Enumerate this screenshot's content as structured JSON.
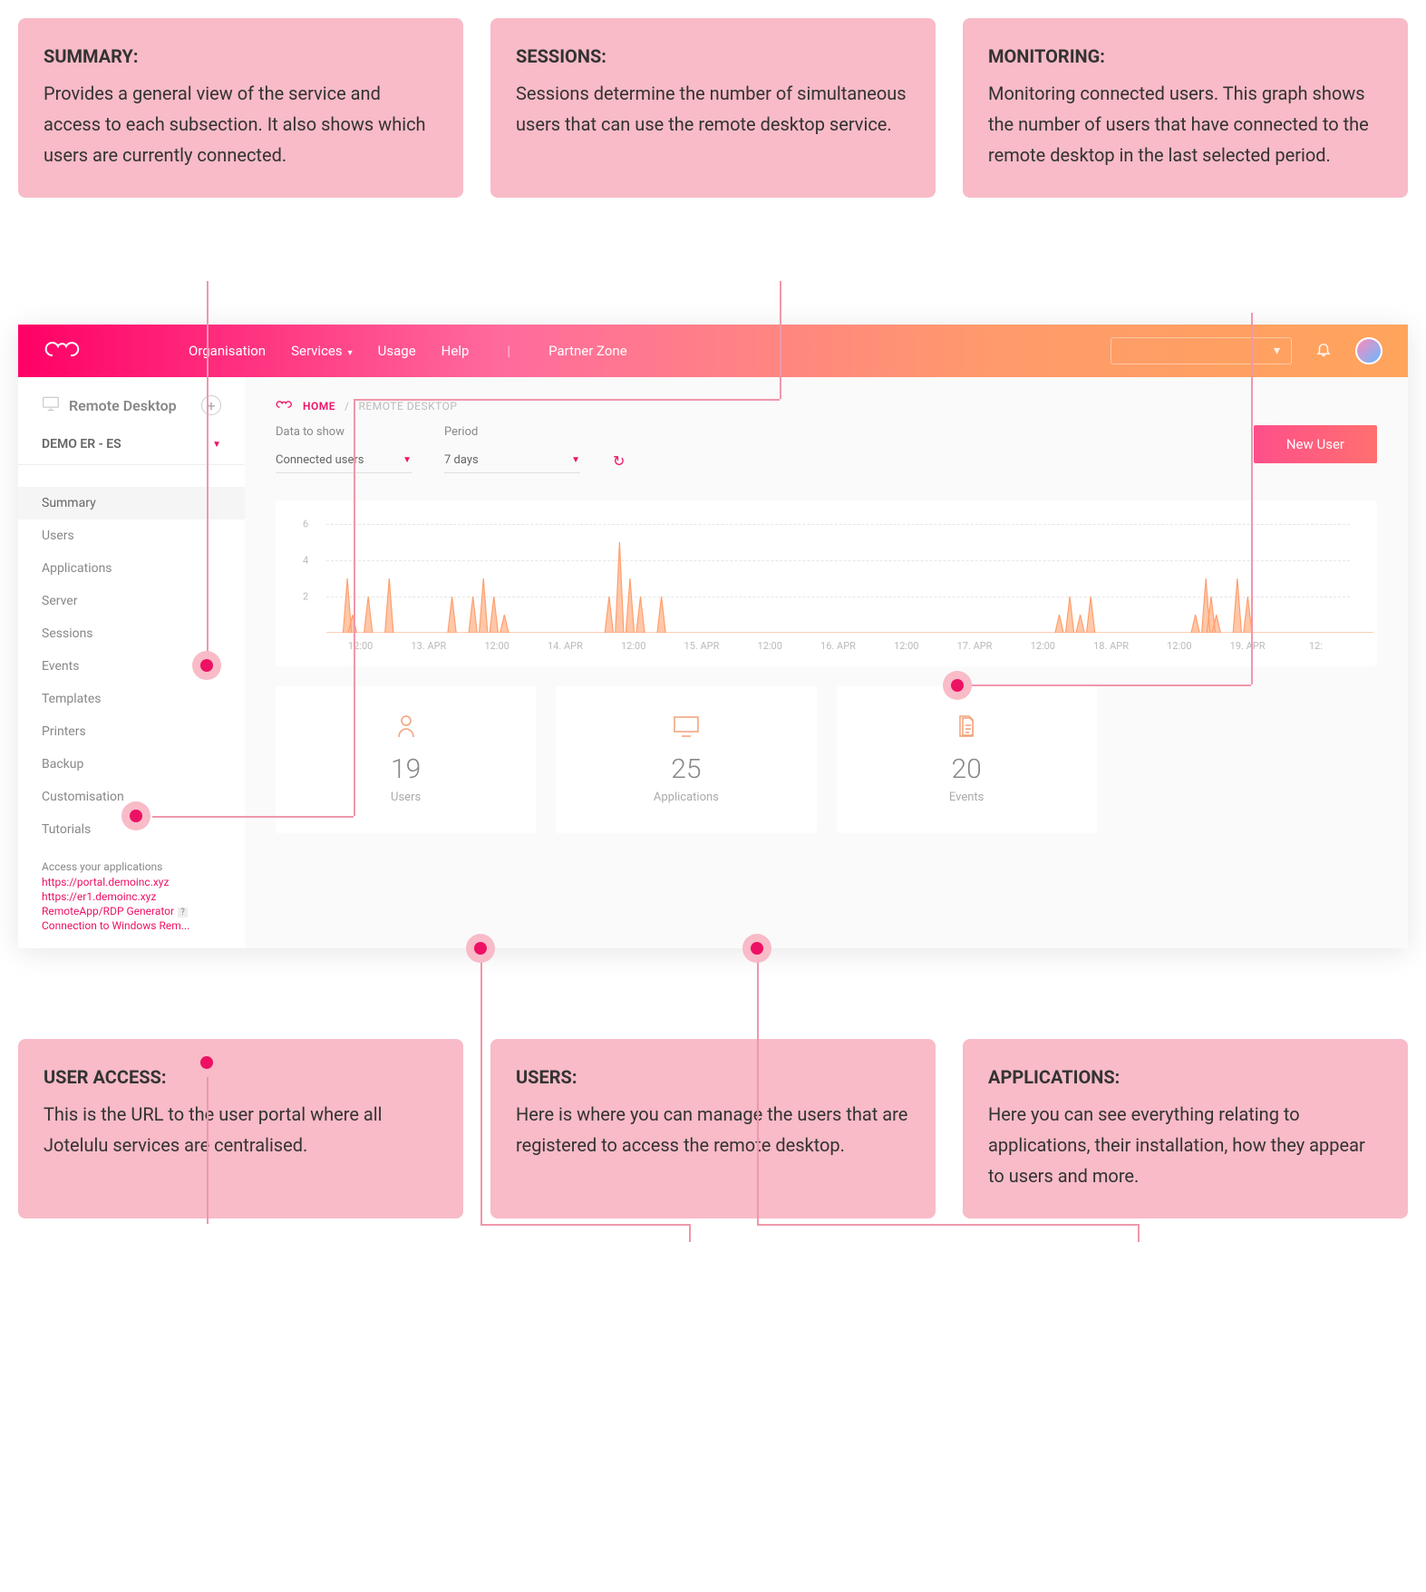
{
  "callouts": {
    "top": [
      {
        "title": "SUMMARY:",
        "text": "Provides a general view of the service and access to each subsection. It also shows which users are currently connected."
      },
      {
        "title": "SESSIONS:",
        "text": "Sessions determine the number of simultaneous users that can use the remote desktop service."
      },
      {
        "title": "MONITORING:",
        "text": "Monitoring connected users. This graph shows the number of users that have connected to the remote desktop in the last selected period."
      }
    ],
    "bottom": [
      {
        "title": "USER ACCESS:",
        "text": "This is the URL to the user portal where all Jotelulu services are centralised."
      },
      {
        "title": "USERS:",
        "text": "Here is where you can manage the users that are registered to access the remote desktop."
      },
      {
        "title": "APPLICATIONS:",
        "text": "Here you can see everything relating to applications, their installation, how they appear to users and more."
      }
    ]
  },
  "topbar": {
    "nav": [
      "Organisation",
      "Services",
      "Usage",
      "Help"
    ],
    "partner": "Partner Zone"
  },
  "sidebar": {
    "title": "Remote Desktop",
    "demo": "DEMO ER - ES",
    "items": [
      "Summary",
      "Users",
      "Applications",
      "Server",
      "Sessions",
      "Events",
      "Templates",
      "Printers",
      "Backup",
      "Customisation",
      "Tutorials"
    ],
    "access": {
      "title": "Access your applications",
      "links": [
        "https://portal.demoinc.xyz",
        "https://er1.demoinc.xyz",
        "RemoteApp/RDP Generator",
        "Connection to Windows Rem..."
      ]
    }
  },
  "breadcrumb": {
    "home": "HOME",
    "section": "REMOTE DESKTOP"
  },
  "controls": {
    "data_label": "Data to show",
    "data_value": "Connected users",
    "period_label": "Period",
    "period_value": "7 days",
    "new_user": "New User"
  },
  "chart_data": {
    "type": "line",
    "title": "",
    "ylim": [
      0,
      6
    ],
    "y_ticks": [
      2,
      4,
      6
    ],
    "categories": [
      "12:00",
      "13. APR",
      "12:00",
      "14. APR",
      "12:00",
      "15. APR",
      "12:00",
      "16. APR",
      "12:00",
      "17. APR",
      "12:00",
      "18. APR",
      "12:00",
      "19. APR",
      "12:"
    ],
    "peaks": [
      {
        "x": 0.02,
        "v": 3
      },
      {
        "x": 0.025,
        "v": 1
      },
      {
        "x": 0.04,
        "v": 2
      },
      {
        "x": 0.06,
        "v": 3
      },
      {
        "x": 0.12,
        "v": 2
      },
      {
        "x": 0.14,
        "v": 2
      },
      {
        "x": 0.15,
        "v": 3
      },
      {
        "x": 0.16,
        "v": 2
      },
      {
        "x": 0.17,
        "v": 1
      },
      {
        "x": 0.27,
        "v": 2
      },
      {
        "x": 0.28,
        "v": 5
      },
      {
        "x": 0.29,
        "v": 3
      },
      {
        "x": 0.3,
        "v": 2
      },
      {
        "x": 0.32,
        "v": 2
      },
      {
        "x": 0.7,
        "v": 1
      },
      {
        "x": 0.71,
        "v": 2
      },
      {
        "x": 0.72,
        "v": 1
      },
      {
        "x": 0.73,
        "v": 2
      },
      {
        "x": 0.83,
        "v": 1
      },
      {
        "x": 0.84,
        "v": 3
      },
      {
        "x": 0.845,
        "v": 2
      },
      {
        "x": 0.85,
        "v": 1
      },
      {
        "x": 0.87,
        "v": 3
      },
      {
        "x": 0.88,
        "v": 2
      }
    ]
  },
  "stats": [
    {
      "value": "19",
      "label": "Users"
    },
    {
      "value": "25",
      "label": "Applications"
    },
    {
      "value": "20",
      "label": "Events"
    }
  ]
}
